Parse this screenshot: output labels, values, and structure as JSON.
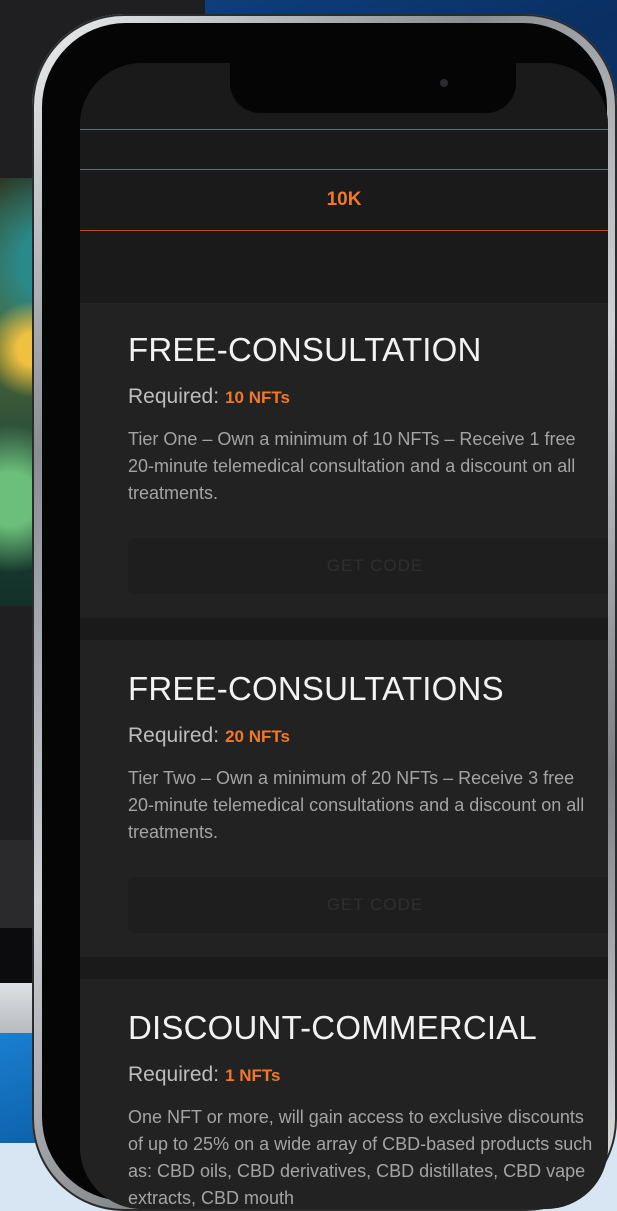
{
  "tab": {
    "label": "10K"
  },
  "cards": [
    {
      "title": "FREE-CONSULTATION",
      "required_label": "Required:",
      "required_value": "10 NFTs",
      "description": "Tier One – Own a minimum of 10 NFTs – Receive 1 free 20-minute telemedical consultation and a discount on all treatments.",
      "button": "GET CODE"
    },
    {
      "title": "FREE-CONSULTATIONS",
      "required_label": "Required:",
      "required_value": "20 NFTs",
      "description": "Tier Two – Own a minimum of 20 NFTs – Receive 3 free 20-minute telemedical consultations and a discount on all treatments.",
      "button": "GET CODE"
    },
    {
      "title": "DISCOUNT-COMMERCIAL",
      "required_label": "Required:",
      "required_value": "1 NFTs",
      "description": "One NFT or more, will gain access to exclusive discounts of up to 25% on a wide array of CBD-based products such as: CBD oils, CBD derivatives, CBD distillates, CBD vape extracts, CBD mouth"
    }
  ],
  "colors": {
    "accent": "#f07828",
    "card_bg": "#222223",
    "screen_bg": "#161617"
  }
}
